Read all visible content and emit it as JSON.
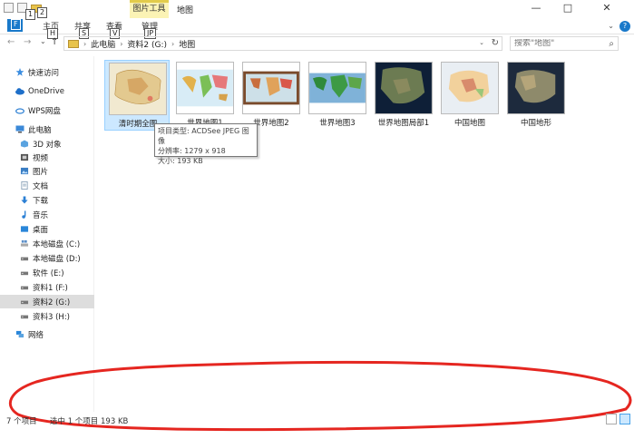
{
  "titlebar": {
    "context_group": "图片工具",
    "title": "地图",
    "key_tips": [
      "1",
      "2"
    ],
    "minimize": "—",
    "maximize": "□",
    "close": "✕"
  },
  "ribbon": {
    "file_tab": "文",
    "file_key": "F",
    "tabs": [
      {
        "label": "主页",
        "key": "H"
      },
      {
        "label": "共享",
        "key": "S"
      },
      {
        "label": "查看",
        "key": "V"
      },
      {
        "label": "管理",
        "key": "JP"
      }
    ],
    "collapse_glyph": "⌄",
    "help_glyph": "?"
  },
  "address": {
    "back": "←",
    "forward": "→",
    "recent": "⌄",
    "up": "↑",
    "crumbs": [
      "此电脑",
      "资料2 (G:)",
      "地图"
    ],
    "separator": "›",
    "dropdown": "⌄",
    "refresh": "↻"
  },
  "search": {
    "placeholder": "搜索\"地图\"",
    "icon": "⌕"
  },
  "sidebar": {
    "items": [
      {
        "label": "快速访问",
        "icon": "star-icon",
        "color": "#3c8ee0"
      },
      {
        "label": "OneDrive",
        "icon": "cloud-icon",
        "color": "#1e6fc9"
      },
      {
        "label": "WPS网盘",
        "icon": "cloud-outline-icon",
        "color": "#2b7fd3"
      },
      {
        "label": "此电脑",
        "icon": "computer-icon",
        "color": "#3b89d8"
      },
      {
        "label": "3D 对象",
        "icon": "cube-icon",
        "color": "#5aa3e0"
      },
      {
        "label": "视频",
        "icon": "film-icon",
        "color": "#555"
      },
      {
        "label": "图片",
        "icon": "picture-icon",
        "color": "#3a7ec4"
      },
      {
        "label": "文档",
        "icon": "document-icon",
        "color": "#8aa2b8"
      },
      {
        "label": "下载",
        "icon": "download-icon",
        "color": "#2a7fd4"
      },
      {
        "label": "音乐",
        "icon": "music-icon",
        "color": "#2a7fd4"
      },
      {
        "label": "桌面",
        "icon": "desktop-icon",
        "color": "#2a86d9"
      },
      {
        "label": "本地磁盘 (C:)",
        "icon": "windows-drive-icon",
        "color": "#5b8fc8"
      },
      {
        "label": "本地磁盘 (D:)",
        "icon": "drive-icon",
        "color": "#666"
      },
      {
        "label": "软件 (E:)",
        "icon": "drive-icon",
        "color": "#666"
      },
      {
        "label": "资料1 (F:)",
        "icon": "drive-icon",
        "color": "#666"
      },
      {
        "label": "资料2 (G:)",
        "icon": "drive-icon",
        "color": "#666",
        "selected": true
      },
      {
        "label": "资料3 (H:)",
        "icon": "drive-icon",
        "color": "#666"
      },
      {
        "label": "网络",
        "icon": "network-icon",
        "color": "#2a86d9"
      }
    ]
  },
  "files": [
    {
      "name": "清时期全图",
      "selected": true,
      "bg": "#f1e9d0",
      "fg": "#c9a35a"
    },
    {
      "name": "世界地图1",
      "bg": "#d8ecf6",
      "fg": "#e2b14c"
    },
    {
      "name": "世界地图2",
      "bg": "#cde0e8",
      "fg": "#c96e3e"
    },
    {
      "name": "世界地图3",
      "bg": "#7fb2d8",
      "fg": "#2f8a3a"
    },
    {
      "name": "世界地图局部1",
      "bg": "#0e1f37",
      "fg": "#6c7b52"
    },
    {
      "name": "中国地图",
      "bg": "#e9eef3",
      "fg": "#d88b6c"
    },
    {
      "name": "中国地形",
      "bg": "#1d2a3d",
      "fg": "#8e8a6b"
    }
  ],
  "tooltip": {
    "type": "项目类型: ACDSee JPEG 图像",
    "resolution": "分辨率: 1279 x 918",
    "size": "大小: 193 KB"
  },
  "status": {
    "count": "7 个项目",
    "selected": "选中 1 个项目  193 KB"
  },
  "colors": {
    "accent": "#1979ca",
    "selection": "#cce8ff",
    "annotation": "#e52620"
  }
}
